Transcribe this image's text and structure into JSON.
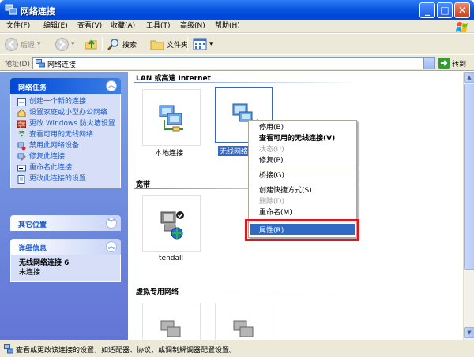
{
  "window": {
    "title": "网络连接"
  },
  "menu": [
    "文件(F)",
    "编辑(E)",
    "查看(V)",
    "收藏(A)",
    "工具(T)",
    "高级(N)",
    "帮助(H)"
  ],
  "toolbar": {
    "back": "后退",
    "search": "搜索",
    "folders": "文件夹"
  },
  "address": {
    "label": "地址(D)",
    "value": "网络连接",
    "go": "转到"
  },
  "network_tasks": {
    "title": "网络任务",
    "items": [
      "创建一个新的连接",
      "设置家庭或小型办公网络",
      "更改 Windows 防火墙设置",
      "查看可用的无线网络",
      "禁用此网络设备",
      "修复此连接",
      "重命名此连接",
      "更改此连接的设置"
    ]
  },
  "other_places": {
    "title": "其它位置"
  },
  "details": {
    "title": "详细信息",
    "name": "无线网络连接 6",
    "status": "未连接"
  },
  "groups": {
    "lan": "LAN 或高速 Internet",
    "broadband": "宽带",
    "vpn": "虚拟专用网络"
  },
  "connections": {
    "local": "本地连接",
    "wireless": "无线网络",
    "tendall": "tendall"
  },
  "context_menu": {
    "disable": "停用(B)",
    "view_wireless": "查看可用的无线连接(V)",
    "status": "状态(U)",
    "repair": "修复(P)",
    "bridge": "桥接(G)",
    "shortcut": "创建快捷方式(S)",
    "delete": "删除(D)",
    "rename": "重命名(M)",
    "properties": "属性(R)"
  },
  "status_bar": "查看或更改该连接的设置，如适配器、协议、或调制解调器配置设置。",
  "colors": {
    "title_bar": "#0a56e0",
    "selection": "#316ac5",
    "highlight_box": "#e3141a",
    "task_link": "#215dc6"
  }
}
